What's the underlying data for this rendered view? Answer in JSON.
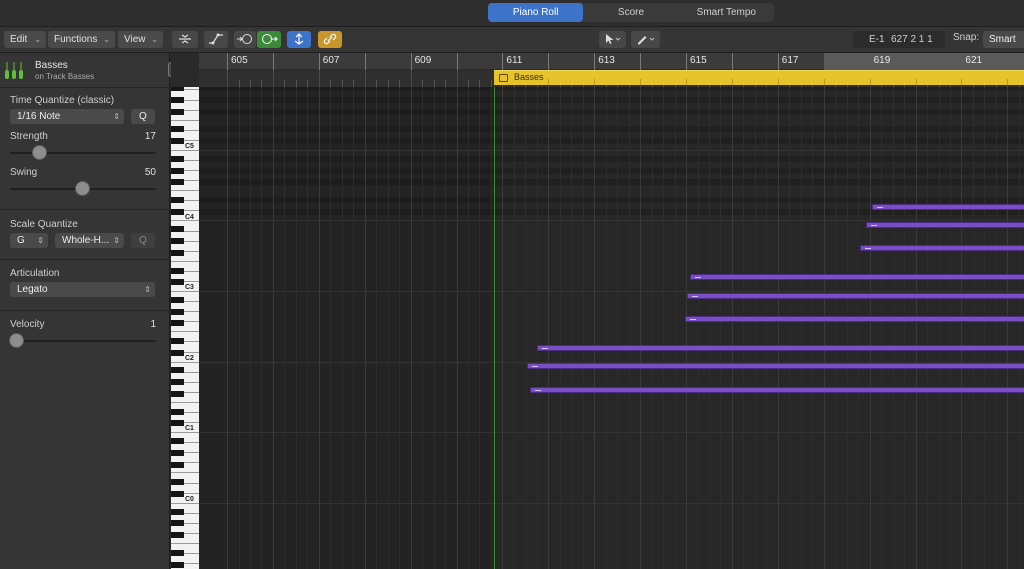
{
  "tabs": [
    {
      "label": "Piano Roll",
      "active": true
    },
    {
      "label": "Score",
      "active": false
    },
    {
      "label": "Smart Tempo",
      "active": false
    }
  ],
  "toolbar": {
    "edit": "Edit",
    "functions": "Functions",
    "view": "View",
    "position_key": "E-1",
    "position_value": "627 2 1 1",
    "snap_label": "Snap:",
    "snap_value": "Smart",
    "icons": [
      "collapse-icon",
      "automation-curve-icon",
      "midi-in-icon",
      "midi-out-icon",
      "catch-playhead-icon",
      "link-icon",
      "pointer-tool-icon",
      "pencil-tool-icon"
    ]
  },
  "inspector": {
    "track_name": "Basses",
    "track_sub": "on Track Basses",
    "time_quantize_label": "Time Quantize (classic)",
    "time_quantize_value": "1/16 Note",
    "q_button": "Q",
    "strength_label": "Strength",
    "strength_value": "17",
    "swing_label": "Swing",
    "swing_value": "50",
    "scale_quantize_label": "Scale Quantize",
    "scale_root": "G",
    "scale_type": "Whole-H...",
    "articulation_label": "Articulation",
    "articulation_value": "Legato",
    "velocity_label": "Velocity",
    "velocity_value": "1"
  },
  "keyboard": {
    "c_labels": [
      "C5",
      "C4",
      "C3",
      "C2",
      "C1",
      "C0"
    ]
  },
  "ruler": {
    "bars": [
      "605",
      "607",
      "609",
      "611",
      "613",
      "615",
      "617",
      "619",
      "621"
    ]
  },
  "region": {
    "name": "Basses"
  },
  "colors": {
    "accent": "#3d74c9",
    "region": "#e6c32b",
    "note": "#7a4fc6",
    "playhead": "#3c8c3c"
  }
}
